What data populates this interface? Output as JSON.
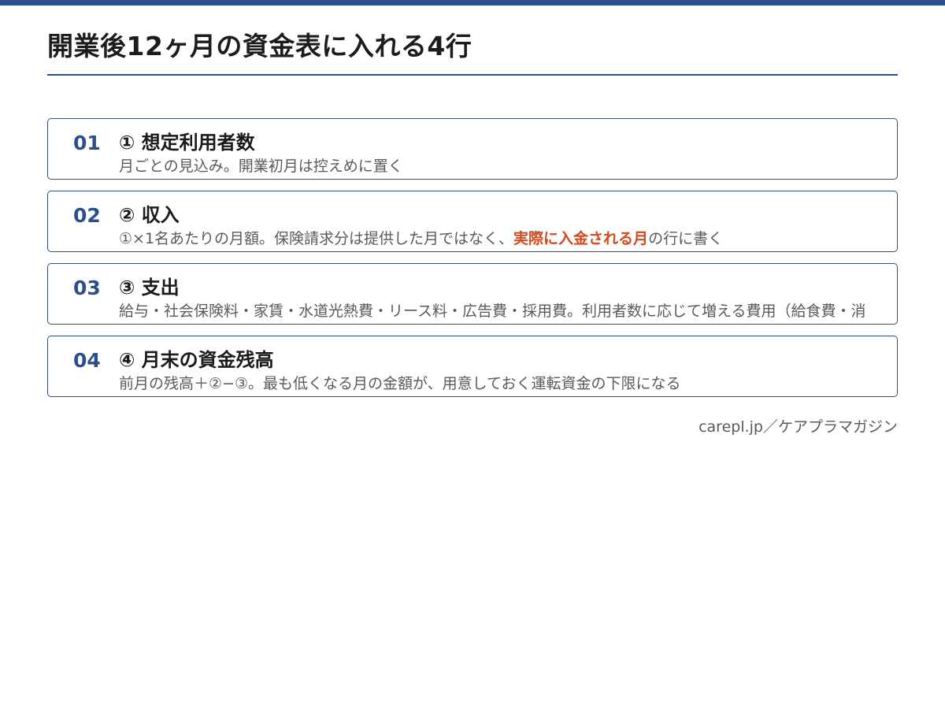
{
  "page": {
    "title": "開業後12ヶ月の資金表に入れる4行",
    "source": "carepl.jp／ケアプラマガジン"
  },
  "colors": {
    "accent_bar": "#2a4f8c",
    "number_blue": "#2a4f8c",
    "highlight": "#d24a1f"
  },
  "rows": [
    {
      "number": "01",
      "heading": "① 想定利用者数",
      "detail": "月ごとの見込み。開業初月は控えめに置く"
    },
    {
      "number": "02",
      "heading": "② 収入",
      "detail_before": "①×1名あたりの月額。保険請求分は提供した月ではなく、",
      "detail_highlight": "実際に入金される月",
      "detail_after": "の行に書く"
    },
    {
      "number": "03",
      "heading": "③ 支出",
      "detail": "給与・社会保険料・家賃・水道光熱費・リース料・広告費・採用費。利用者数に応じて増える費用（給食費・消"
    },
    {
      "number": "04",
      "heading": "④ 月末の資金残高",
      "detail": "前月の残高＋②−③。最も低くなる月の金額が、用意しておく運転資金の下限になる"
    }
  ]
}
